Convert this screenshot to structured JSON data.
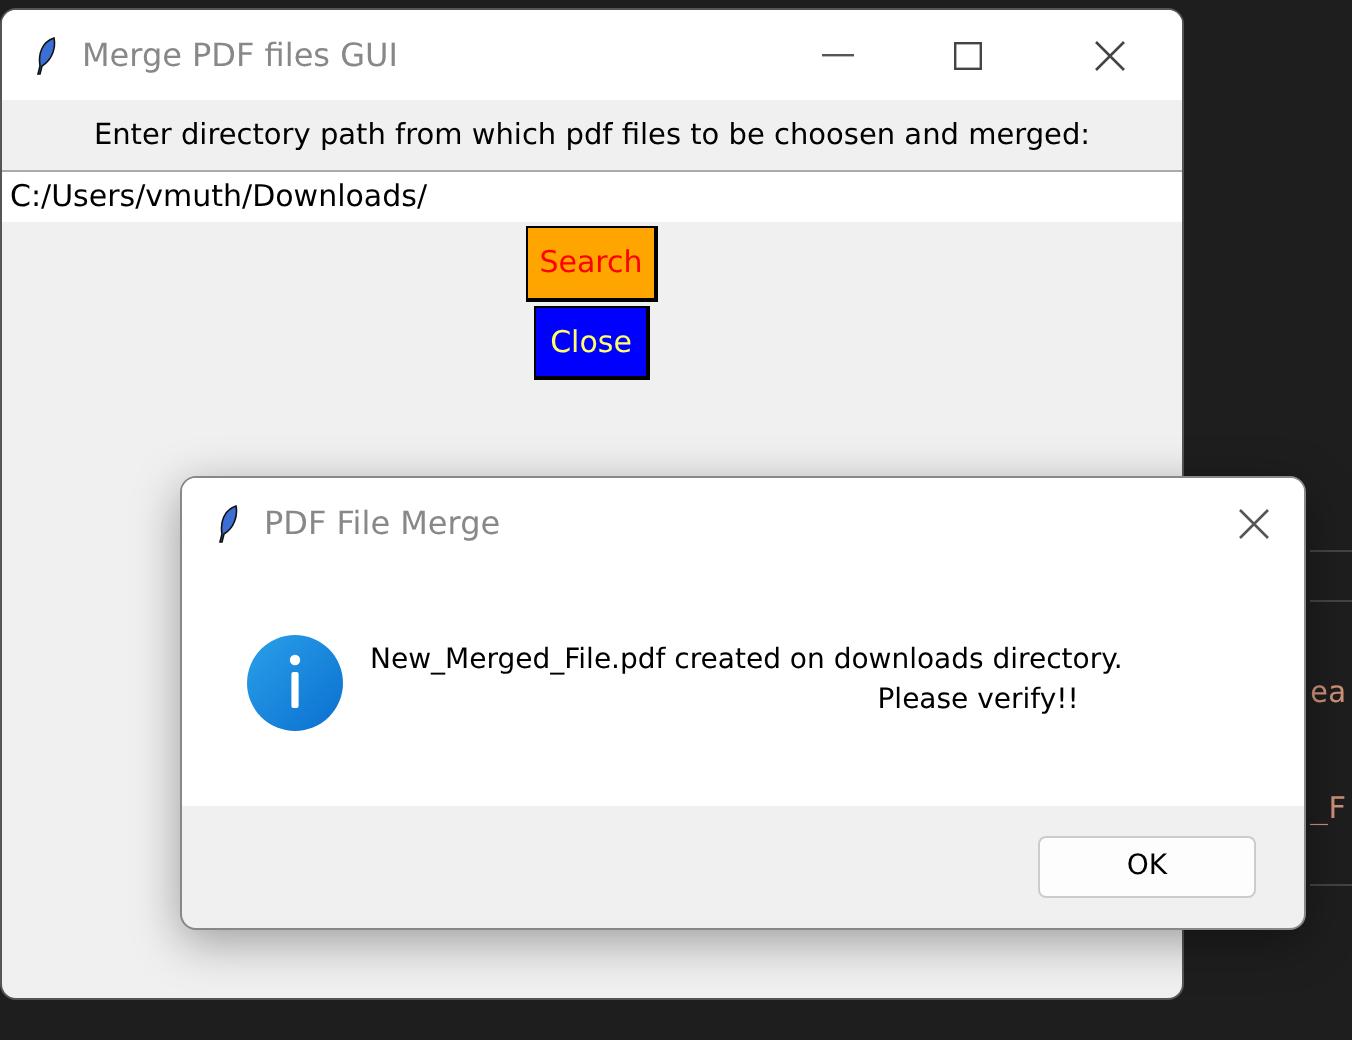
{
  "editor": {
    "fragments": [
      "ea",
      "_F"
    ]
  },
  "main_window": {
    "title": "Merge PDF files GUI",
    "prompt": "Enter directory path from which pdf files to be choosen and merged:",
    "path_field": {
      "value": "C:/Users/vmuth/Downloads/"
    },
    "buttons": [
      "Search",
      "Close"
    ]
  },
  "dialog": {
    "title": "PDF File Merge",
    "message_lines": [
      "New_Merged_File.pdf created on downloads directory.",
      "Please verify!!"
    ],
    "button": "OK"
  }
}
